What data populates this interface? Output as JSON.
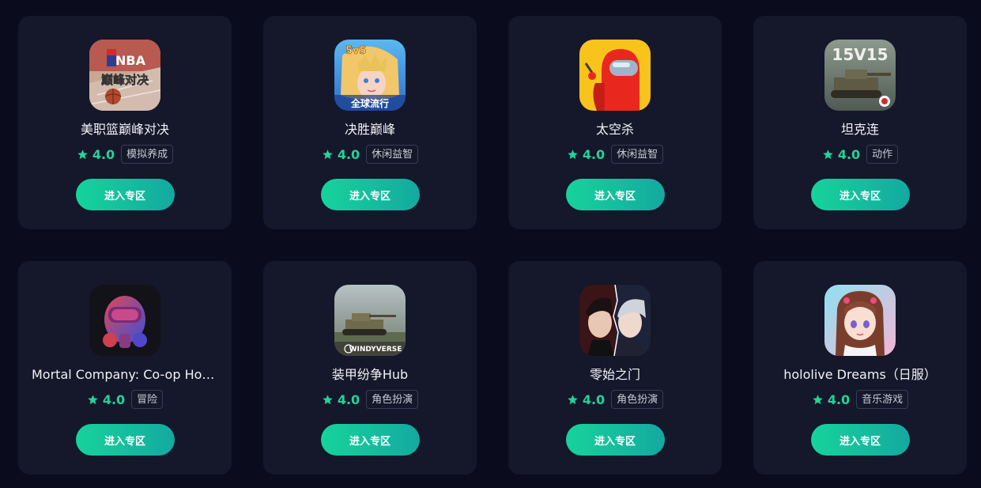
{
  "colors": {
    "page_background": "#0a0b1c",
    "card_background": "#15172a",
    "accent": "#22d39a",
    "button_gradient": [
      "#16d39b",
      "#14a9a0"
    ]
  },
  "games": [
    {
      "title": "美职篮巅峰对决",
      "rating": "4.0",
      "tag": "模拟养成",
      "button_label": "进入专区",
      "icon": "nba-game-icon",
      "icon_text": [
        "NBA",
        "巅峰对决"
      ]
    },
    {
      "title": "决胜巅峰",
      "rating": "4.0",
      "tag": "休闲益智",
      "button_label": "进入专区",
      "icon": "hero-game-icon",
      "icon_text": [
        "5v5",
        "全球流行"
      ]
    },
    {
      "title": "太空杀",
      "rating": "4.0",
      "tag": "休闲益智",
      "button_label": "进入专区",
      "icon": "crewmate-game-icon"
    },
    {
      "title": "坦克连",
      "rating": "4.0",
      "tag": "动作",
      "button_label": "进入专区",
      "icon": "tank-game-icon",
      "icon_text": [
        "15V15"
      ]
    },
    {
      "title": "Mortal Company: Co-op Horror",
      "rating": "4.0",
      "tag": "冒险",
      "button_label": "进入专区",
      "icon": "robot-game-icon"
    },
    {
      "title": "装甲纷争Hub",
      "rating": "4.0",
      "tag": "角色扮演",
      "button_label": "进入专区",
      "icon": "armored-tank-game-icon",
      "icon_text": [
        "WINDYVERSE"
      ]
    },
    {
      "title": "零始之门",
      "rating": "4.0",
      "tag": "角色扮演",
      "button_label": "进入专区",
      "icon": "anime-boys-game-icon"
    },
    {
      "title": "hololive Dreams（日服）",
      "rating": "4.0",
      "tag": "音乐游戏",
      "button_label": "进入专区",
      "icon": "anime-girl-game-icon"
    }
  ]
}
